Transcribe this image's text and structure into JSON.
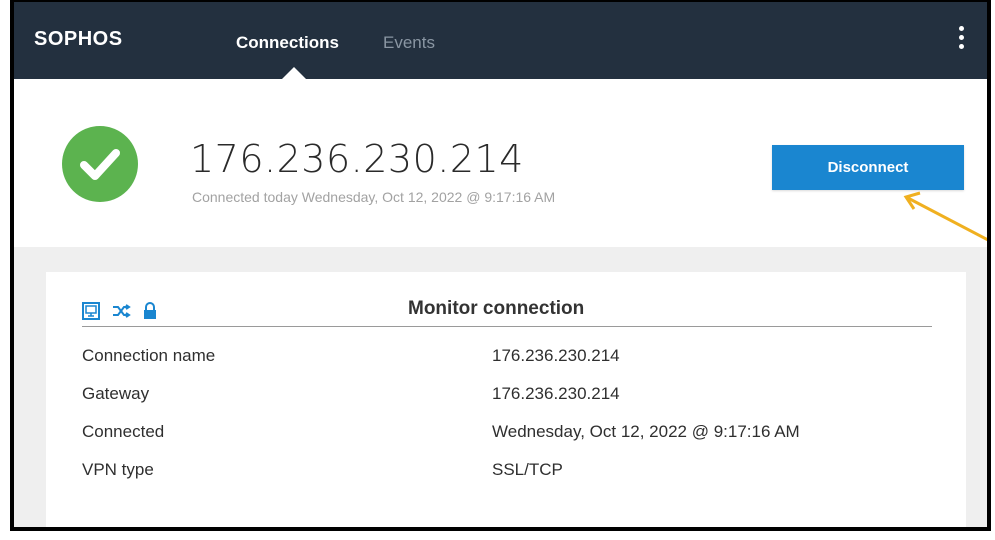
{
  "header": {
    "logo": "SOPHOS",
    "tabs": [
      {
        "label": "Connections",
        "active": true
      },
      {
        "label": "Events",
        "active": false
      }
    ],
    "menu_icon": "kebab-menu-icon"
  },
  "status": {
    "icon": "check-circle-icon",
    "ip": "176.236.230.214",
    "connected_text": "Connected today Wednesday, Oct 12, 2022 @ 9:17:16 AM",
    "disconnect_label": "Disconnect"
  },
  "monitor": {
    "title": "Monitor connection",
    "icons": [
      "monitor-icon",
      "shuffle-icon",
      "lock-icon"
    ],
    "rows": [
      {
        "label": "Connection name",
        "value": "176.236.230.214"
      },
      {
        "label": "Gateway",
        "value": "176.236.230.214"
      },
      {
        "label": "Connected",
        "value": "Wednesday, Oct 12, 2022 @ 9:17:16 AM"
      },
      {
        "label": "VPN type",
        "value": "SSL/TCP"
      }
    ]
  },
  "colors": {
    "topbar": "#23303f",
    "accent": "#1a86d0",
    "success": "#5cb34f",
    "annotation_arrow": "#f0b020"
  }
}
